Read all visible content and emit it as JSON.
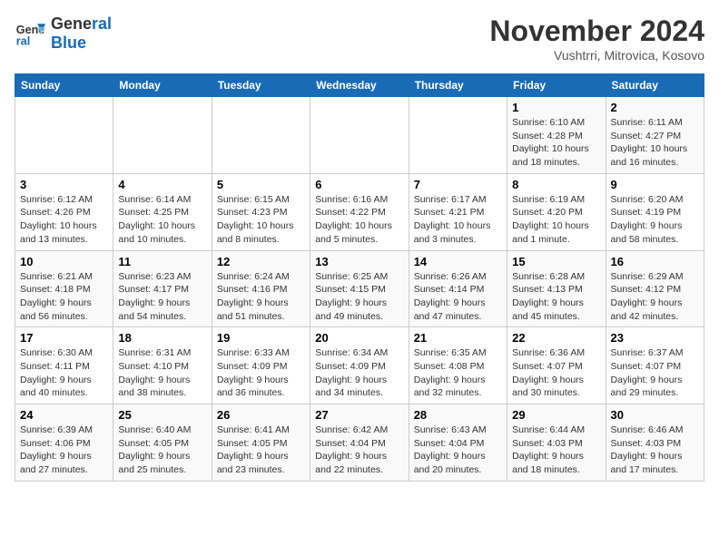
{
  "header": {
    "logo_line1": "General",
    "logo_line2": "Blue",
    "month": "November 2024",
    "location": "Vushtrri, Mitrovica, Kosovo"
  },
  "weekdays": [
    "Sunday",
    "Monday",
    "Tuesday",
    "Wednesday",
    "Thursday",
    "Friday",
    "Saturday"
  ],
  "weeks": [
    [
      {
        "day": "",
        "info": ""
      },
      {
        "day": "",
        "info": ""
      },
      {
        "day": "",
        "info": ""
      },
      {
        "day": "",
        "info": ""
      },
      {
        "day": "",
        "info": ""
      },
      {
        "day": "1",
        "info": "Sunrise: 6:10 AM\nSunset: 4:28 PM\nDaylight: 10 hours\nand 18 minutes."
      },
      {
        "day": "2",
        "info": "Sunrise: 6:11 AM\nSunset: 4:27 PM\nDaylight: 10 hours\nand 16 minutes."
      }
    ],
    [
      {
        "day": "3",
        "info": "Sunrise: 6:12 AM\nSunset: 4:26 PM\nDaylight: 10 hours\nand 13 minutes."
      },
      {
        "day": "4",
        "info": "Sunrise: 6:14 AM\nSunset: 4:25 PM\nDaylight: 10 hours\nand 10 minutes."
      },
      {
        "day": "5",
        "info": "Sunrise: 6:15 AM\nSunset: 4:23 PM\nDaylight: 10 hours\nand 8 minutes."
      },
      {
        "day": "6",
        "info": "Sunrise: 6:16 AM\nSunset: 4:22 PM\nDaylight: 10 hours\nand 5 minutes."
      },
      {
        "day": "7",
        "info": "Sunrise: 6:17 AM\nSunset: 4:21 PM\nDaylight: 10 hours\nand 3 minutes."
      },
      {
        "day": "8",
        "info": "Sunrise: 6:19 AM\nSunset: 4:20 PM\nDaylight: 10 hours\nand 1 minute."
      },
      {
        "day": "9",
        "info": "Sunrise: 6:20 AM\nSunset: 4:19 PM\nDaylight: 9 hours\nand 58 minutes."
      }
    ],
    [
      {
        "day": "10",
        "info": "Sunrise: 6:21 AM\nSunset: 4:18 PM\nDaylight: 9 hours\nand 56 minutes."
      },
      {
        "day": "11",
        "info": "Sunrise: 6:23 AM\nSunset: 4:17 PM\nDaylight: 9 hours\nand 54 minutes."
      },
      {
        "day": "12",
        "info": "Sunrise: 6:24 AM\nSunset: 4:16 PM\nDaylight: 9 hours\nand 51 minutes."
      },
      {
        "day": "13",
        "info": "Sunrise: 6:25 AM\nSunset: 4:15 PM\nDaylight: 9 hours\nand 49 minutes."
      },
      {
        "day": "14",
        "info": "Sunrise: 6:26 AM\nSunset: 4:14 PM\nDaylight: 9 hours\nand 47 minutes."
      },
      {
        "day": "15",
        "info": "Sunrise: 6:28 AM\nSunset: 4:13 PM\nDaylight: 9 hours\nand 45 minutes."
      },
      {
        "day": "16",
        "info": "Sunrise: 6:29 AM\nSunset: 4:12 PM\nDaylight: 9 hours\nand 42 minutes."
      }
    ],
    [
      {
        "day": "17",
        "info": "Sunrise: 6:30 AM\nSunset: 4:11 PM\nDaylight: 9 hours\nand 40 minutes."
      },
      {
        "day": "18",
        "info": "Sunrise: 6:31 AM\nSunset: 4:10 PM\nDaylight: 9 hours\nand 38 minutes."
      },
      {
        "day": "19",
        "info": "Sunrise: 6:33 AM\nSunset: 4:09 PM\nDaylight: 9 hours\nand 36 minutes."
      },
      {
        "day": "20",
        "info": "Sunrise: 6:34 AM\nSunset: 4:09 PM\nDaylight: 9 hours\nand 34 minutes."
      },
      {
        "day": "21",
        "info": "Sunrise: 6:35 AM\nSunset: 4:08 PM\nDaylight: 9 hours\nand 32 minutes."
      },
      {
        "day": "22",
        "info": "Sunrise: 6:36 AM\nSunset: 4:07 PM\nDaylight: 9 hours\nand 30 minutes."
      },
      {
        "day": "23",
        "info": "Sunrise: 6:37 AM\nSunset: 4:07 PM\nDaylight: 9 hours\nand 29 minutes."
      }
    ],
    [
      {
        "day": "24",
        "info": "Sunrise: 6:39 AM\nSunset: 4:06 PM\nDaylight: 9 hours\nand 27 minutes."
      },
      {
        "day": "25",
        "info": "Sunrise: 6:40 AM\nSunset: 4:05 PM\nDaylight: 9 hours\nand 25 minutes."
      },
      {
        "day": "26",
        "info": "Sunrise: 6:41 AM\nSunset: 4:05 PM\nDaylight: 9 hours\nand 23 minutes."
      },
      {
        "day": "27",
        "info": "Sunrise: 6:42 AM\nSunset: 4:04 PM\nDaylight: 9 hours\nand 22 minutes."
      },
      {
        "day": "28",
        "info": "Sunrise: 6:43 AM\nSunset: 4:04 PM\nDaylight: 9 hours\nand 20 minutes."
      },
      {
        "day": "29",
        "info": "Sunrise: 6:44 AM\nSunset: 4:03 PM\nDaylight: 9 hours\nand 18 minutes."
      },
      {
        "day": "30",
        "info": "Sunrise: 6:46 AM\nSunset: 4:03 PM\nDaylight: 9 hours\nand 17 minutes."
      }
    ]
  ]
}
